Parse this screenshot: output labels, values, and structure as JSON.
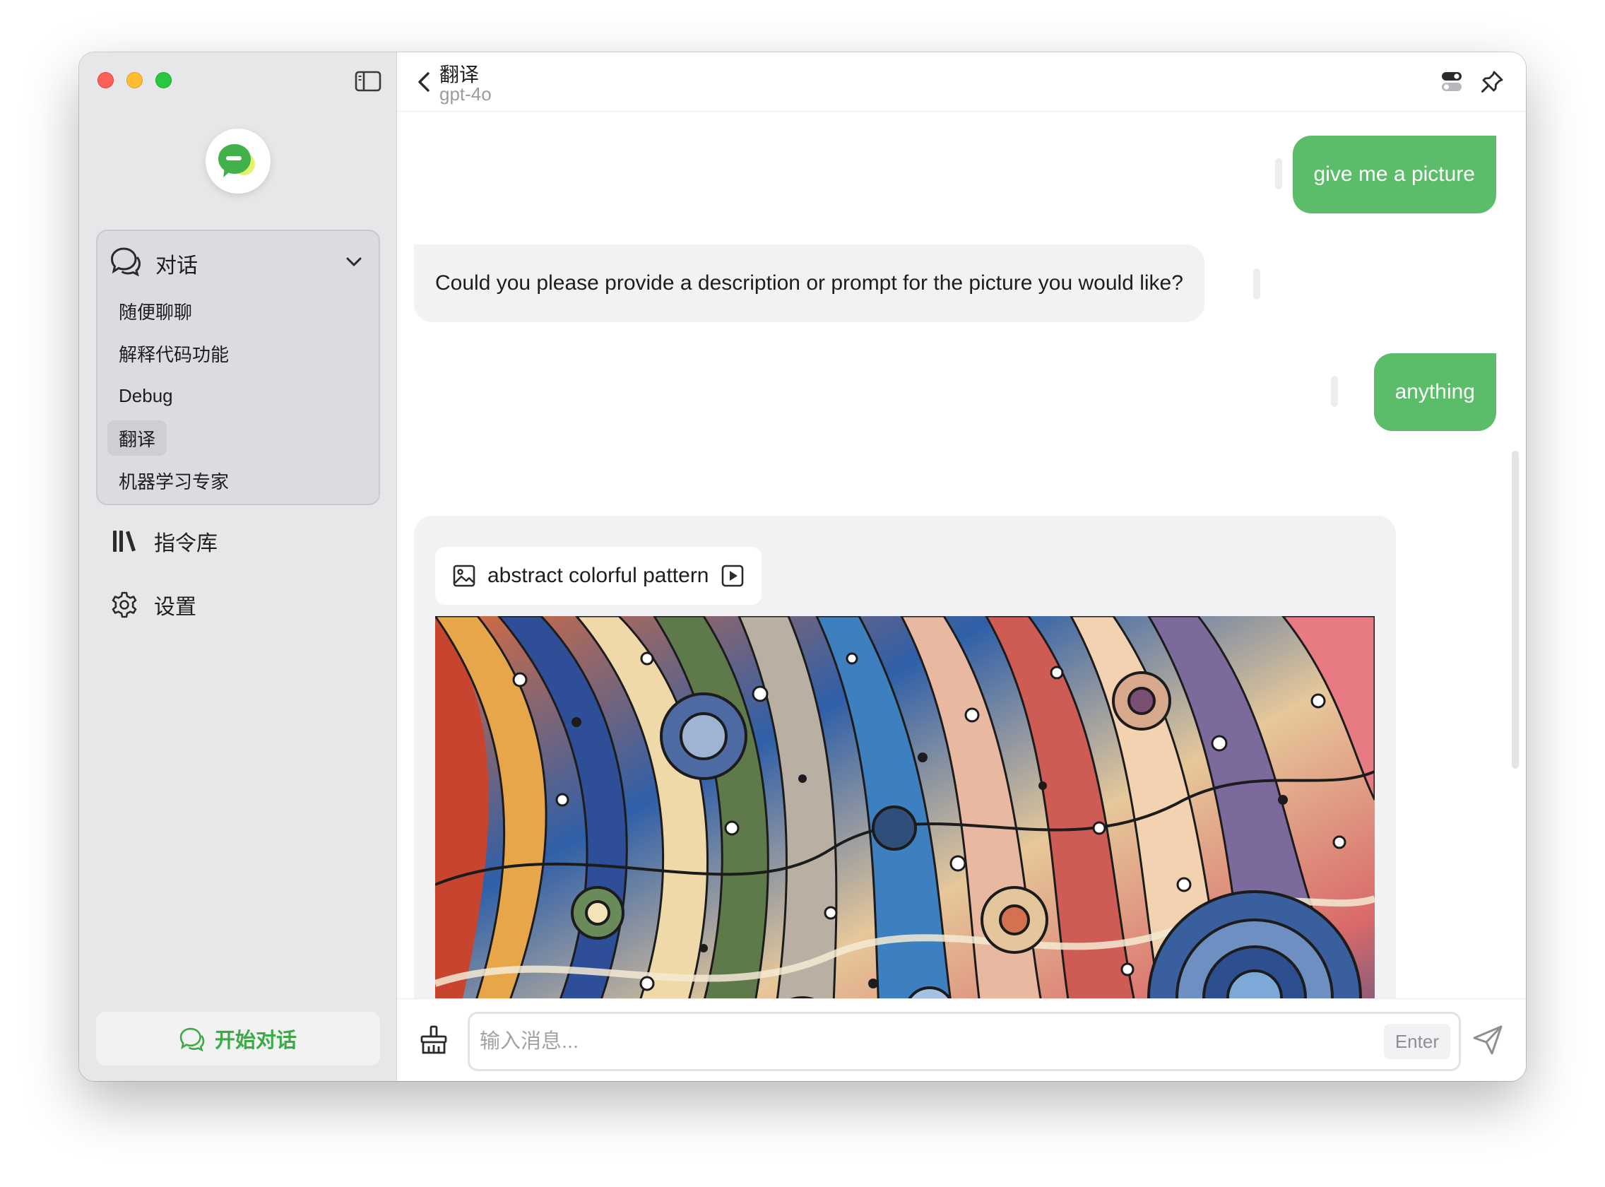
{
  "sidebar": {
    "group_title": "对话",
    "group_items": [
      {
        "label": "随便聊聊",
        "active": false
      },
      {
        "label": "解释代码功能",
        "active": false
      },
      {
        "label": "Debug",
        "active": false
      },
      {
        "label": "翻译",
        "active": true
      },
      {
        "label": "机器学习专家",
        "active": false
      }
    ],
    "nav_library": "指令库",
    "nav_settings": "设置",
    "start_button": "开始对话"
  },
  "header": {
    "title": "翻译",
    "model": "gpt-4o"
  },
  "messages": [
    {
      "role": "user",
      "text": "give me a picture"
    },
    {
      "role": "assistant",
      "text": "Could you please provide a description or prompt for the picture you would like?"
    },
    {
      "role": "user",
      "text": "anything"
    },
    {
      "role": "assistant",
      "image_prompt": "abstract colorful pattern"
    }
  ],
  "input": {
    "placeholder": "输入消息...",
    "enter_hint": "Enter"
  },
  "colors": {
    "accent": "#5bbd6a",
    "sidebar_bg": "#e7e7e9",
    "bubble_assistant": "#f2f2f4"
  },
  "icons": {
    "logo": "chat-bubble-logo",
    "group": "chat-bubbles-icon",
    "library": "library-books-icon",
    "settings": "gear-icon",
    "back": "chevron-left-icon",
    "toggle": "toggle-switch-icon",
    "pin": "pin-icon",
    "image": "image-icon",
    "play": "play-square-icon",
    "download": "download-icon",
    "clear": "broom-icon",
    "send": "paper-plane-icon"
  }
}
